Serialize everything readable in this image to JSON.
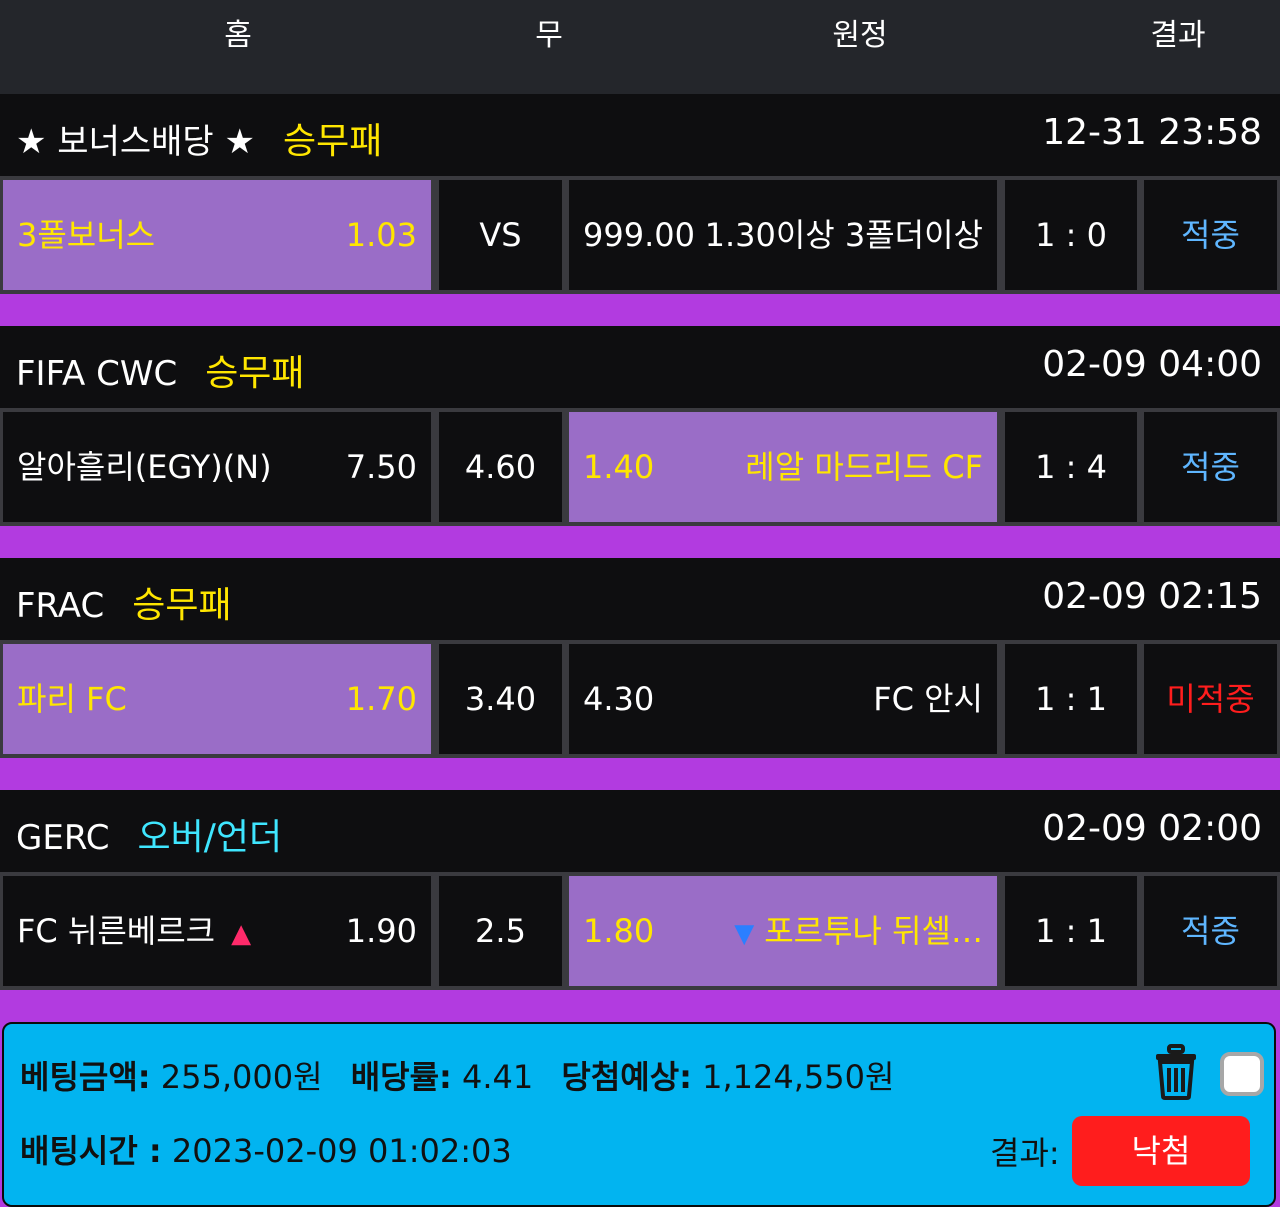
{
  "header": {
    "home": "홈",
    "draw": "무",
    "away": "원정",
    "result": "결과"
  },
  "games": [
    {
      "league": "★ 보너스배당 ★",
      "bet_type": "승무패",
      "bet_type_color": "#ffe600",
      "time": "12-31 23:58",
      "home_team": "3폴보너스",
      "home_odd": "1.03",
      "draw": "VS",
      "away_odd": "999.00",
      "away_team": "1.30이상 3폴더이상",
      "score": "1 : 0",
      "result": "적중",
      "result_color": "#5fb6ff",
      "selected": "home"
    },
    {
      "league": "FIFA CWC",
      "bet_type": "승무패",
      "bet_type_color": "#ffe600",
      "time": "02-09 04:00",
      "home_team": "알아흘리(EGY)(N)",
      "home_odd": "7.50",
      "draw": "4.60",
      "away_odd": "1.40",
      "away_team": "레알 마드리드 CF",
      "score": "1 : 4",
      "result": "적중",
      "result_color": "#5fb6ff",
      "selected": "away"
    },
    {
      "league": "FRAC",
      "bet_type": "승무패",
      "bet_type_color": "#ffe600",
      "time": "02-09 02:15",
      "home_team": "파리 FC",
      "home_odd": "1.70",
      "draw": "3.40",
      "away_odd": "4.30",
      "away_team": "FC 안시",
      "score": "1 : 1",
      "result": "미적중",
      "result_color": "#ff1d1d",
      "selected": "home"
    },
    {
      "league": "GERC",
      "bet_type": "오버/언더",
      "bet_type_color": "#3fe6ff",
      "time": "02-09 02:00",
      "home_team": "FC 뉘른베르크",
      "home_odd": "1.90",
      "draw": "2.5",
      "away_odd": "1.80",
      "away_team": "포르투나 뒤셀…",
      "score": "1 : 1",
      "result": "적중",
      "result_color": "#5fb6ff",
      "selected": "away",
      "home_icon": "triangle-up-icon",
      "away_icon": "triangle-down-icon"
    }
  ],
  "footer": {
    "bet_amount_label": "베팅금액:",
    "bet_amount": "255,000원",
    "odds_label": "배당률:",
    "odds": "4.41",
    "expected_label": "당첨예상:",
    "expected": "1,124,550원",
    "bet_time_label": "배팅시간 :",
    "bet_time": "2023-02-09 01:02:03",
    "result_label": "결과:",
    "result_button": "낙첨",
    "icons": [
      "trash-icon",
      "checkbox"
    ]
  },
  "colors": {
    "selected_bg": "#9a6dc7",
    "selected_text": "#ffe600",
    "background": "#b23be0",
    "footer_bg": "#02b4f0"
  }
}
